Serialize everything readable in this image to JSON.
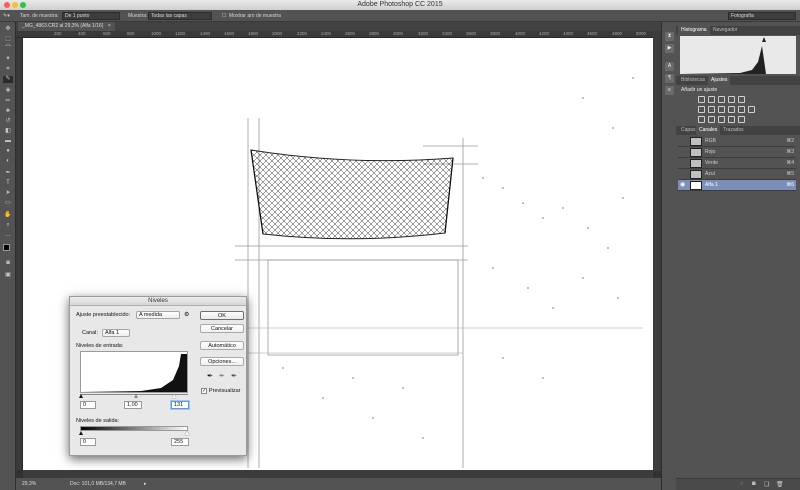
{
  "app": {
    "title": "Adobe Photoshop CC 2015"
  },
  "options_bar": {
    "sample_size_label": "Tam. de muestra:",
    "sample_size_value": "De 1 punto",
    "sample_label": "Muestra:",
    "sample_value": "Todas las capas",
    "show_ring_label": "Mostrar aro de muestra",
    "workspace_value": "Fotografía"
  },
  "document": {
    "tab_label": "_MG_4863.CR2 al 29,3% (Alfa 1/16)",
    "close_glyph": "×"
  },
  "ruler": {
    "h_ticks": [
      "200",
      "400",
      "600",
      "800",
      "1000",
      "1200",
      "1400",
      "1600",
      "1800",
      "2000",
      "2200",
      "2400",
      "2600",
      "2800",
      "3000",
      "3200",
      "3400",
      "3600",
      "3800",
      "4000",
      "4200",
      "4400",
      "4600",
      "4800",
      "5000"
    ]
  },
  "status": {
    "zoom": "29,3%",
    "doc_info": "Doc: 101,0 MB/134,7 MB"
  },
  "panels": {
    "top_tabs": [
      "Histograma",
      "Navegador"
    ],
    "mid_tabs": [
      "Bibliotecas",
      "Ajustes"
    ],
    "adjust_hint": "Añadir un ajuste",
    "bottom_tabs": [
      "Capas",
      "Canales",
      "Trazados"
    ],
    "channels": [
      {
        "name": "RGB",
        "key": "⌘2"
      },
      {
        "name": "Rojo",
        "key": "⌘3"
      },
      {
        "name": "Verde",
        "key": "⌘4"
      },
      {
        "name": "Azul",
        "key": "⌘5"
      },
      {
        "name": "Alfa 1",
        "key": "⌘6"
      }
    ]
  },
  "levels_dialog": {
    "title": "Niveles",
    "preset_label": "Ajuste preestablecido:",
    "preset_value": "A medida",
    "channel_label": "Canal:",
    "channel_value": "Alfa 1",
    "input_levels_label": "Niveles de entrada:",
    "input_black": "0",
    "input_gamma": "1,00",
    "input_white": "131",
    "output_levels_label": "Niveles de salida:",
    "output_black": "0",
    "output_white": "255",
    "ok_label": "OK",
    "cancel_label": "Cancelar",
    "auto_label": "Automático",
    "options_label": "Opciones...",
    "preview_label": "Previsualizar",
    "preview_checked": true
  }
}
